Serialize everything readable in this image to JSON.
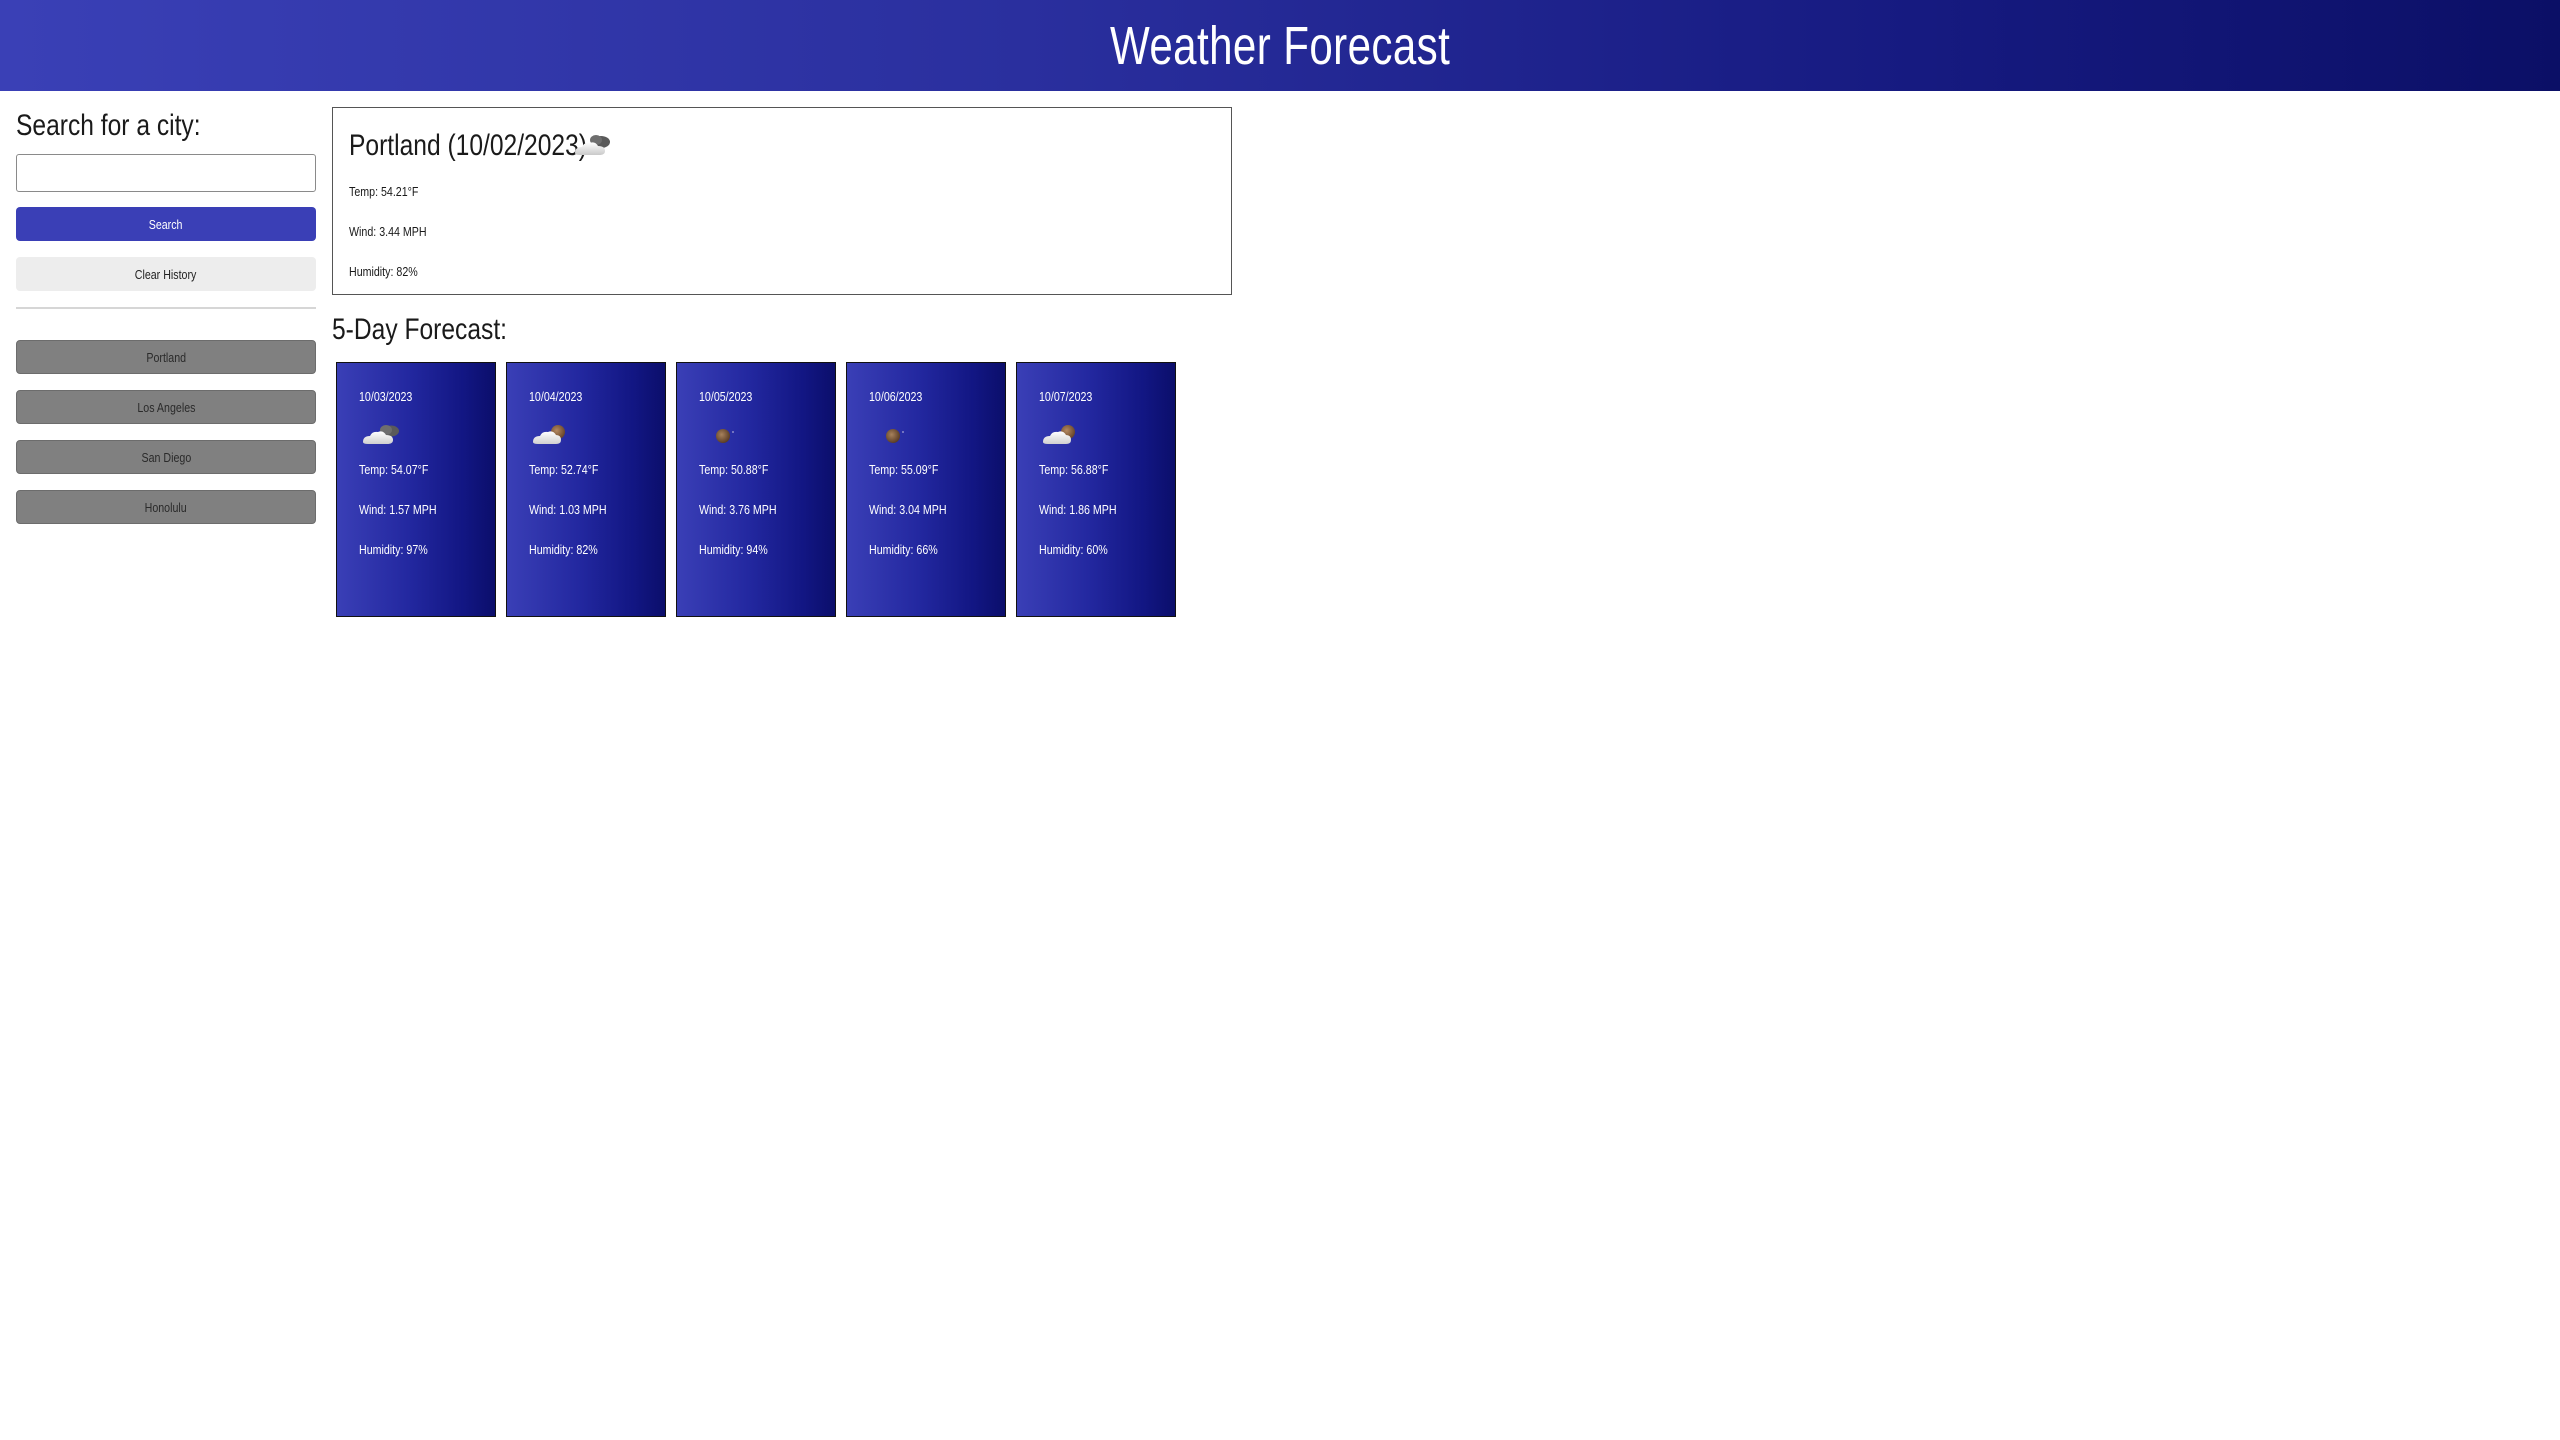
{
  "header": {
    "title": "Weather Forecast"
  },
  "sidebar": {
    "search_heading": "Search for a city:",
    "search_input": {
      "value": "",
      "placeholder": ""
    },
    "search_button": "Search",
    "clear_button": "Clear History",
    "history": [
      "Portland",
      "Los Angeles",
      "San Diego",
      "Honolulu"
    ]
  },
  "current": {
    "title": "Portland (10/02/2023)",
    "icon": "cloudy-night-icon",
    "temp": "Temp: 54.21°F",
    "wind": "Wind: 3.44 MPH",
    "humidity": "Humidity: 82%"
  },
  "forecast": {
    "heading": "5-Day Forecast:",
    "days": [
      {
        "date": "10/03/2023",
        "icon": "cloudy-night-icon",
        "temp": "Temp: 54.07°F",
        "wind": "Wind: 1.57 MPH",
        "humidity": "Humidity: 97%"
      },
      {
        "date": "10/04/2023",
        "icon": "partly-cloudy-night-icon",
        "temp": "Temp: 52.74°F",
        "wind": "Wind: 1.03 MPH",
        "humidity": "Humidity: 82%"
      },
      {
        "date": "10/05/2023",
        "icon": "moon-icon",
        "temp": "Temp: 50.88°F",
        "wind": "Wind: 3.76 MPH",
        "humidity": "Humidity: 94%"
      },
      {
        "date": "10/06/2023",
        "icon": "moon-icon",
        "temp": "Temp: 55.09°F",
        "wind": "Wind: 3.04 MPH",
        "humidity": "Humidity: 66%"
      },
      {
        "date": "10/07/2023",
        "icon": "partly-cloudy-night-icon",
        "temp": "Temp: 56.88°F",
        "wind": "Wind: 1.86 MPH",
        "humidity": "Humidity: 60%"
      }
    ]
  },
  "colors": {
    "accent": "#3a3fb6",
    "header_dark": "#0b0f66",
    "history_button": "#808080",
    "clear_button": "#ededed"
  }
}
